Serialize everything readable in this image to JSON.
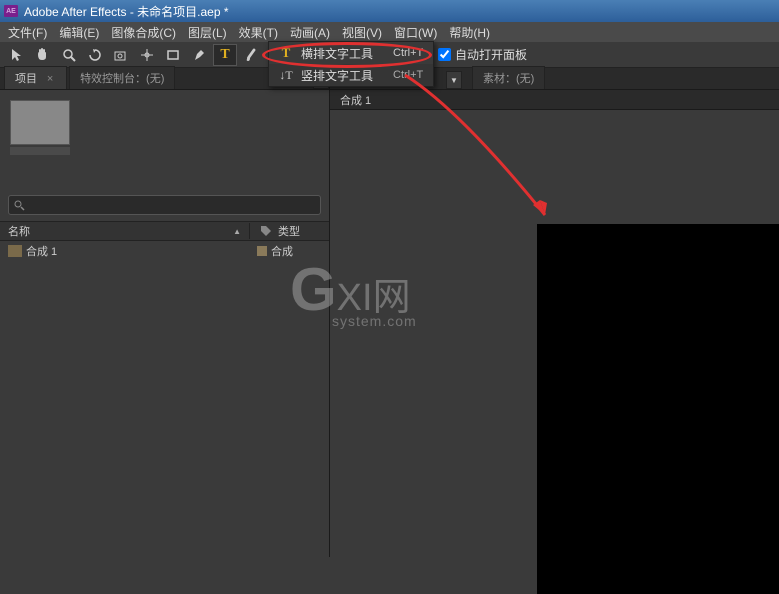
{
  "titlebar": {
    "app_icon_text": "AE",
    "title": "Adobe After Effects - 未命名项目.aep *"
  },
  "menu": {
    "file": "文件(F)",
    "edit": "编辑(E)",
    "composition": "图像合成(C)",
    "layer": "图层(L)",
    "effect": "效果(T)",
    "animation": "动画(A)",
    "view": "视图(V)",
    "window": "窗口(W)",
    "help": "帮助(H)"
  },
  "text_tool_dropdown": {
    "horizontal": {
      "label": "横排文字工具",
      "shortcut": "Ctrl+T"
    },
    "vertical": {
      "label": "竖排文字工具",
      "shortcut": "Ctrl+T"
    }
  },
  "toolbar_right": {
    "auto_open_panel": "自动打开面板"
  },
  "left_tabs": {
    "project": "项目",
    "project_close": "×",
    "effect_controls": "特效控制台：(无)"
  },
  "right_tabs": {
    "material": "素材：(无)"
  },
  "search": {
    "placeholder": ""
  },
  "list": {
    "header_name": "名称",
    "header_type": "类型",
    "row1_name": "合成 1",
    "row1_type": "合成"
  },
  "comp_tab": "合成 1",
  "watermark": {
    "g": "G",
    "xi": "XI",
    "wang": "网",
    "sub": "system.com"
  }
}
